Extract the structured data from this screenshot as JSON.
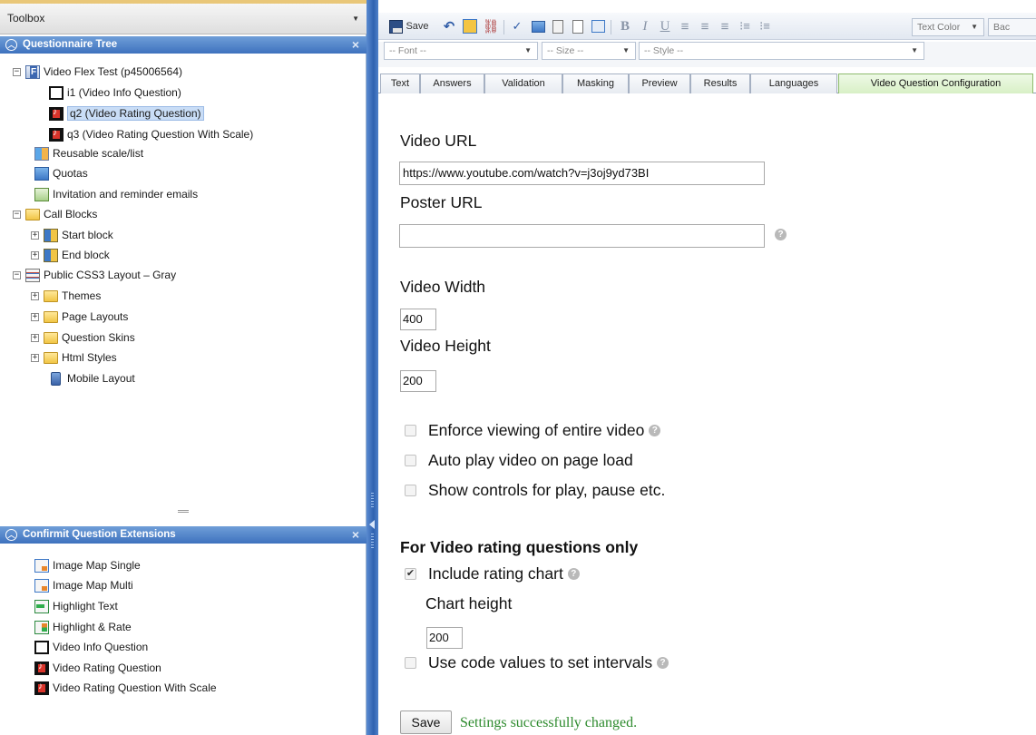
{
  "toolbox": {
    "title": "Toolbox"
  },
  "tree_panel": {
    "title": "Questionnaire Tree",
    "items": [
      {
        "label": "Video Flex Test (p45006564)"
      },
      {
        "label": "i1 (Video Info Question)"
      },
      {
        "label": "q2 (Video Rating Question)"
      },
      {
        "label": "q3 (Video Rating Question With Scale)"
      },
      {
        "label": "Reusable scale/list"
      },
      {
        "label": "Quotas"
      },
      {
        "label": "Invitation and reminder emails"
      },
      {
        "label": "Call Blocks"
      },
      {
        "label": "Start block"
      },
      {
        "label": "End block"
      },
      {
        "label": "Public CSS3 Layout – Gray"
      },
      {
        "label": "Themes"
      },
      {
        "label": "Page Layouts"
      },
      {
        "label": "Question Skins"
      },
      {
        "label": "Html Styles"
      },
      {
        "label": "Mobile Layout"
      }
    ]
  },
  "extensions_panel": {
    "title": "Confirmit Question Extensions",
    "items": [
      {
        "label": "Image Map Single"
      },
      {
        "label": "Image Map Multi"
      },
      {
        "label": "Highlight Text"
      },
      {
        "label": "Highlight & Rate"
      },
      {
        "label": "Video Info Question"
      },
      {
        "label": "Video Rating Question"
      },
      {
        "label": "Video Rating Question With Scale"
      }
    ]
  },
  "toolbar": {
    "save_label": "Save",
    "text_color": "Text Color",
    "bg_color": "Bac",
    "font_placeholder": "-- Font --",
    "size_placeholder": "-- Size --",
    "style_placeholder": "-- Style --"
  },
  "tabs": [
    {
      "label": "Text"
    },
    {
      "label": "Answers"
    },
    {
      "label": "Validation"
    },
    {
      "label": "Masking"
    },
    {
      "label": "Preview"
    },
    {
      "label": "Results"
    },
    {
      "label": "Languages"
    },
    {
      "label": "Video Question Configuration"
    }
  ],
  "form": {
    "video_url_label": "Video URL",
    "video_url_value": "https://www.youtube.com/watch?v=j3oj9yd73BI",
    "poster_url_label": "Poster URL",
    "poster_url_value": "",
    "video_width_label": "Video Width",
    "video_width_value": "400",
    "video_height_label": "Video Height",
    "video_height_value": "200",
    "enforce_label": "Enforce viewing of entire video",
    "enforce_checked": false,
    "autoplay_label": "Auto play video on page load",
    "autoplay_checked": false,
    "controls_label": "Show controls for play, pause etc.",
    "controls_checked": false,
    "rating_section_title": "For Video rating questions only",
    "rating_chart_label": "Include rating chart",
    "rating_chart_checked": true,
    "chart_height_label": "Chart height",
    "chart_height_value": "200",
    "code_values_label": "Use code values to set intervals",
    "code_values_checked": false,
    "save_label": "Save",
    "success_message": "Settings successfully changed."
  },
  "colors": {
    "header_blue": "#3e72be",
    "active_tab_green": "#d8f0c6",
    "success_green": "#2e8b2e",
    "selection_blue": "#c9ddf6"
  }
}
